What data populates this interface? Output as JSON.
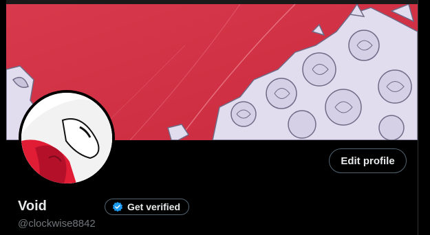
{
  "profile": {
    "display_name": "Void",
    "handle": "@clockwise8842",
    "edit_profile_label": "Edit profile",
    "get_verified_label": "Get verified"
  },
  "colors": {
    "banner_red": "#d63245",
    "verified_blue": "#1d9bf0",
    "text_primary": "#e7e9ea",
    "text_secondary": "#71767b",
    "button_border": "#536471"
  },
  "icons": {
    "verified": "verified-badge-icon"
  }
}
